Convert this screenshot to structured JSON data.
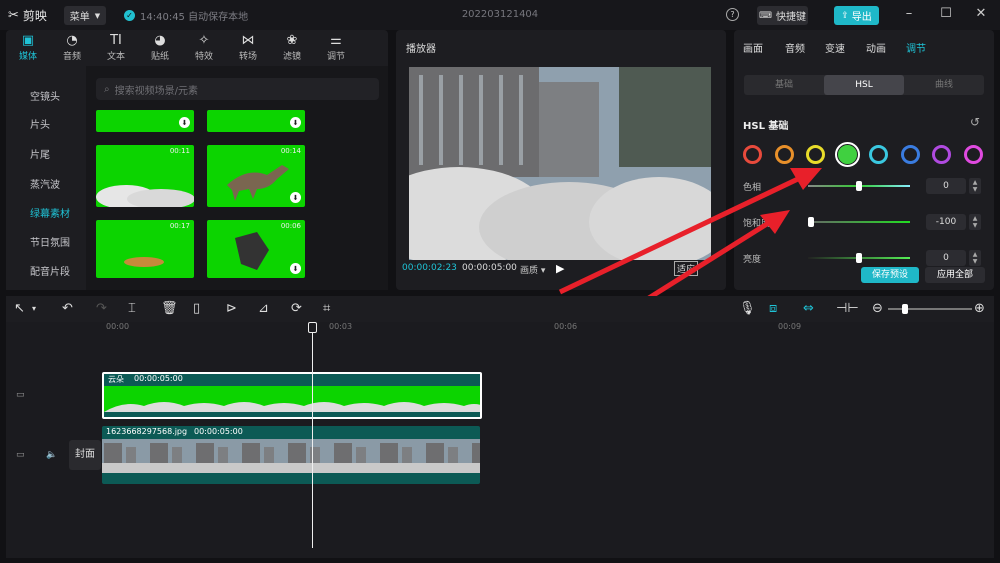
{
  "app": {
    "name": "剪映",
    "menu_label": "菜单",
    "save_status": "14:40:45 自动保存本地",
    "project_title": "202203121404",
    "shortcut_label": "快捷键",
    "export_label": "导出",
    "help": "?"
  },
  "media": {
    "tabs": [
      "媒体",
      "音频",
      "文本",
      "贴纸",
      "特效",
      "转场",
      "滤镜",
      "调节"
    ],
    "sidebar": [
      "空镜头",
      "片头",
      "片尾",
      "蒸汽波",
      "绿幕素材",
      "节日氛围",
      "配音片段"
    ],
    "search_placeholder": "搜索视频场景/元素",
    "durations": [
      "00:11",
      "00:14",
      "00:17",
      "00:06"
    ]
  },
  "player": {
    "title": "播放器",
    "time_current": "00:00:02:23",
    "time_total": "00:00:05:00",
    "ratio_label": "画质",
    "fit_label": "适应"
  },
  "adjust": {
    "tabs": [
      "画面",
      "音频",
      "变速",
      "动画",
      "调节"
    ],
    "subtabs": [
      "基础",
      "HSL",
      "曲线"
    ],
    "section_title": "HSL 基础",
    "rings": [
      "#e84a3c",
      "#e8902a",
      "#e8dc2a",
      "#40d040",
      "#3ac8e0",
      "#3a7ce0",
      "#b04ae0",
      "#e04ae0"
    ],
    "sliders": [
      {
        "label": "色相",
        "value": "0",
        "pos": 0.5
      },
      {
        "label": "饱和度",
        "value": "-100",
        "pos": 0.0
      },
      {
        "label": "亮度",
        "value": "0",
        "pos": 0.5
      }
    ],
    "save_preset": "保存预设",
    "apply_all": "应用全部"
  },
  "timeline": {
    "ruler": [
      "00:00",
      "00:03",
      "00:06",
      "00:09"
    ],
    "clip1_name": "云朵",
    "clip1_duration": "00:00:05:00",
    "clip2_name": "1623668297568.jpg",
    "clip2_duration": "00:00:05:00",
    "cover_label": "封面"
  }
}
